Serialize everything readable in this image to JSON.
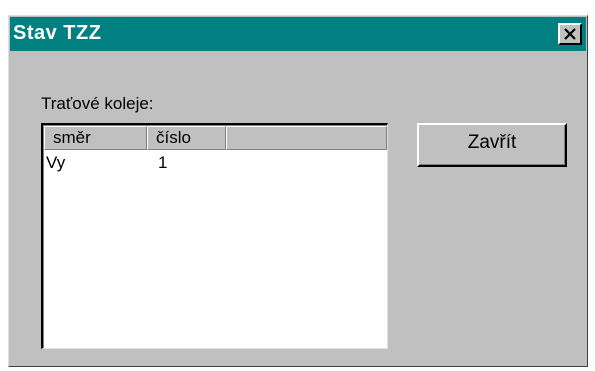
{
  "window": {
    "title": "Stav TZZ",
    "close_icon": "close-x-icon"
  },
  "tracks": {
    "label": "Traťové koleje:",
    "columns": [
      "směr",
      "číslo",
      ""
    ],
    "rows": [
      {
        "smer": "Vy",
        "cislo": "1"
      }
    ]
  },
  "buttons": {
    "close_label": "Zavřít"
  },
  "colors": {
    "titlebar": "#008080",
    "face": "#c0c0c0"
  }
}
